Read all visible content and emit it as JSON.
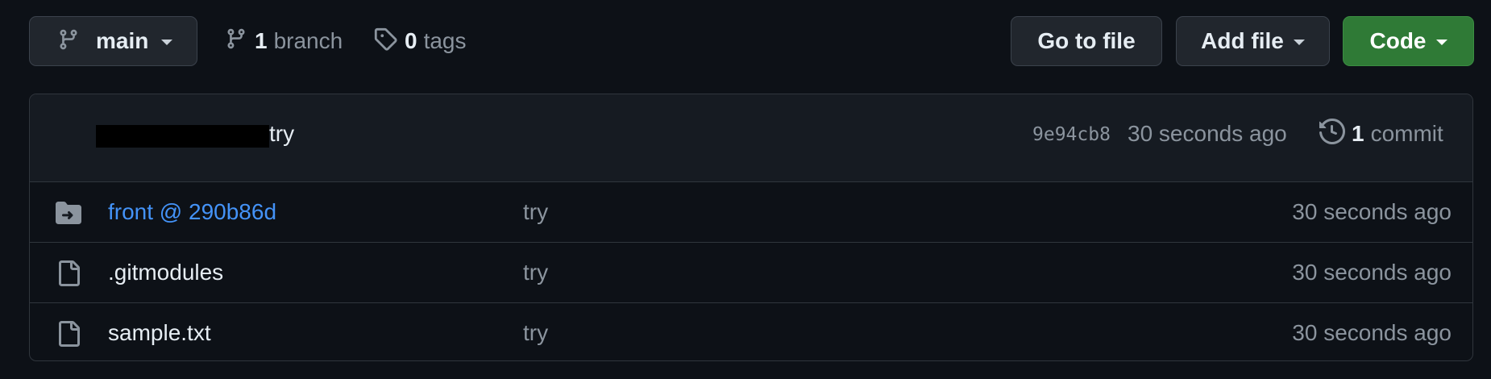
{
  "toolbar": {
    "branch_name": "main",
    "branch_count": "1",
    "branch_label": "branch",
    "tag_count": "0",
    "tag_label": "tags",
    "go_to_file_label": "Go to file",
    "add_file_label": "Add file",
    "code_label": "Code"
  },
  "latest_commit": {
    "message": "try",
    "sha": "9e94cb8",
    "time": "30 seconds ago",
    "commit_count": "1",
    "commit_label": "commit"
  },
  "files": [
    {
      "name": "front @ 290b86d",
      "type": "submodule",
      "message": "try",
      "time": "30 seconds ago"
    },
    {
      "name": ".gitmodules",
      "type": "file",
      "message": "try",
      "time": "30 seconds ago"
    },
    {
      "name": "sample.txt",
      "type": "file",
      "message": "try",
      "time": "30 seconds ago"
    }
  ],
  "colors": {
    "background": "#0d1117",
    "panel_header": "#161b22",
    "border": "#30363d",
    "link": "#4493f8",
    "code_button": "#2f7a36",
    "muted_text": "#8b949e"
  },
  "icons": {
    "branch_select": "git-branch-icon",
    "branch_link": "git-branch-icon",
    "tags_link": "tag-icon",
    "commit_history": "history-icon",
    "submodule": "file-submodule-icon",
    "file": "file-icon"
  }
}
